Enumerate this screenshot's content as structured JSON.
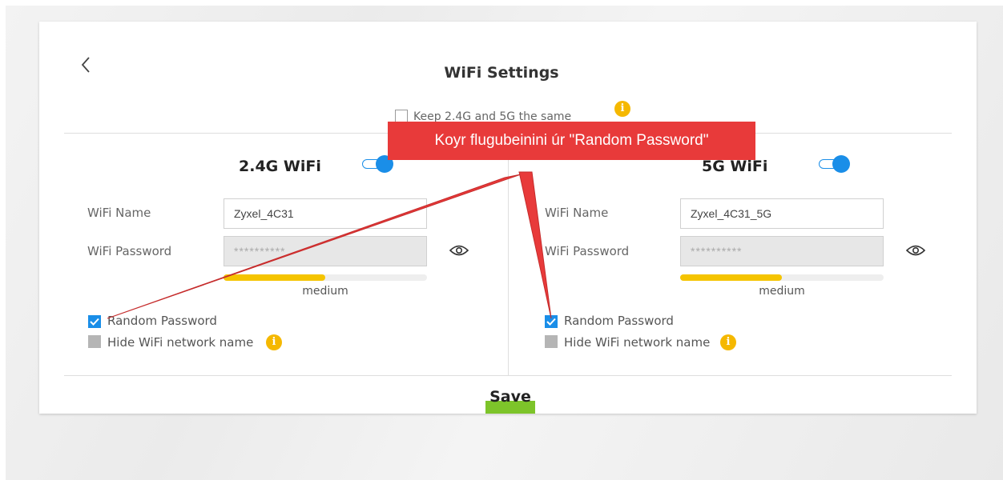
{
  "page": {
    "title": "WiFi Settings",
    "keep_same_label": "Keep 2.4G and 5G the same",
    "info_glyph": "i",
    "save_label": "Save"
  },
  "band_24": {
    "title": "2.4G WiFi",
    "enabled": true,
    "wifi_name_label": "WiFi Name",
    "wifi_name_value": "Zyxel_4C31",
    "wifi_password_label": "WiFi Password",
    "wifi_password_value": "**********",
    "strength_label": "medium",
    "strength_fraction": 0.5,
    "random_password_label": "Random Password",
    "random_password_checked": true,
    "hide_name_label": "Hide WiFi network name",
    "hide_name_checked": false
  },
  "band_5": {
    "title": "5G WiFi",
    "enabled": true,
    "wifi_name_label": "WiFi Name",
    "wifi_name_value": "Zyxel_4C31_5G",
    "wifi_password_label": "WiFi Password",
    "wifi_password_value": "**********",
    "strength_label": "medium",
    "strength_fraction": 0.5,
    "random_password_label": "Random Password",
    "random_password_checked": true,
    "hide_name_label": "Hide WiFi network name",
    "hide_name_checked": false
  },
  "annotation": {
    "callout_text": "Koyr flugubeinini úr \"Random Password\"",
    "color": "#e83a3a"
  },
  "colors": {
    "accent": "#1a8ee8",
    "info": "#f5b800",
    "meter": "#f5c400",
    "save": "#7dc42a"
  }
}
